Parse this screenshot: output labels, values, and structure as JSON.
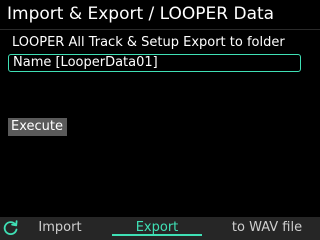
{
  "header": {
    "title": "Import & Export / LOOPER Data"
  },
  "main": {
    "section_label": "LOOPER All Track & Setup Export to folder",
    "name_field_value": "Name [LooperData01]",
    "execute_label": "Execute"
  },
  "tabs": [
    {
      "label": "Import",
      "icon": "refresh-icon",
      "active": false
    },
    {
      "label": "Export",
      "active": true
    },
    {
      "label": "to WAV file",
      "active": false
    }
  ],
  "colors": {
    "accent": "#3fe0b5",
    "background": "#000000",
    "button": "#5a5a5a",
    "tab_bar": "#262626"
  }
}
